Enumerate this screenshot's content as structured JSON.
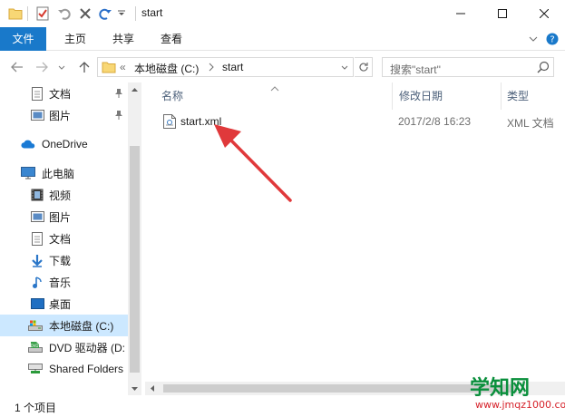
{
  "window": {
    "title": "start",
    "controls": {
      "minimize": "minimize",
      "maximize": "maximize",
      "close": "close"
    }
  },
  "quick_access_toolbar": [
    "folder-icon",
    "properties-icon",
    "undo-icon",
    "delete-icon",
    "redo-icon",
    "customize-dropdown-icon"
  ],
  "ribbon": {
    "tabs": [
      {
        "label": "文件",
        "active": true
      },
      {
        "label": "主页"
      },
      {
        "label": "共享"
      },
      {
        "label": "查看"
      }
    ]
  },
  "address": {
    "overflow": "«",
    "path": [
      "本地磁盘 (C:)",
      "start"
    ]
  },
  "search": {
    "placeholder": "搜索\"start\""
  },
  "nav": {
    "items": [
      {
        "label": "文档",
        "icon": "document-icon",
        "pinned": true
      },
      {
        "label": "图片",
        "icon": "picture-icon",
        "pinned": true
      },
      {
        "label": "OneDrive",
        "icon": "onedrive-cloud-icon"
      },
      {
        "label": "此电脑",
        "icon": "computer-icon"
      },
      {
        "label": "视频",
        "icon": "video-icon"
      },
      {
        "label": "图片",
        "icon": "picture-icon"
      },
      {
        "label": "文档",
        "icon": "document-icon"
      },
      {
        "label": "下载",
        "icon": "download-icon"
      },
      {
        "label": "音乐",
        "icon": "music-icon"
      },
      {
        "label": "桌面",
        "icon": "desktop-icon"
      },
      {
        "label": "本地磁盘 (C:)",
        "icon": "local-disk-icon",
        "selected": true
      },
      {
        "label": "DVD 驱动器 (D:",
        "icon": "dvd-drive-icon"
      },
      {
        "label": "Shared Folders",
        "icon": "shared-folders-icon"
      }
    ]
  },
  "columns": [
    {
      "label": "名称"
    },
    {
      "label": "修改日期"
    },
    {
      "label": "类型"
    }
  ],
  "files": [
    {
      "name": "start.xml",
      "modified": "2017/2/8 16:23",
      "type": "XML 文档"
    }
  ],
  "status": {
    "text": "1 个项目"
  },
  "watermark": {
    "main": "学知网",
    "sub": "www.jmqz1000.com"
  },
  "colors": {
    "accent": "#1979ca",
    "selection": "#cce8ff",
    "annotation_arrow": "#e0393b"
  }
}
